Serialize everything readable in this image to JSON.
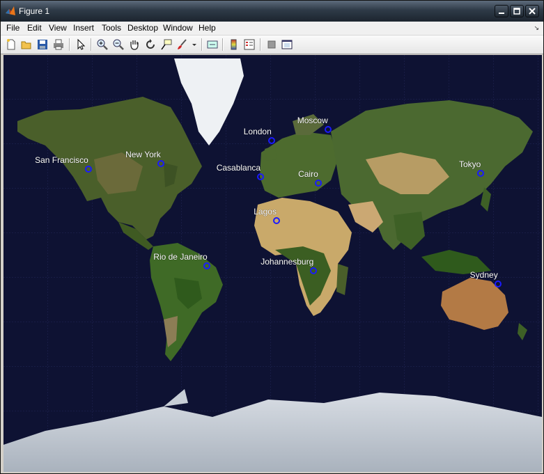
{
  "window": {
    "title": "Figure 1"
  },
  "menu": [
    "File",
    "Edit",
    "View",
    "Insert",
    "Tools",
    "Desktop",
    "Window",
    "Help"
  ],
  "toolbar": {
    "tools": [
      "new-figure",
      "open-file",
      "save",
      "print",
      "edit-plot",
      "zoom-in",
      "zoom-out",
      "pan",
      "rotate-3d",
      "data-cursor",
      "brush",
      "insert-colorbar",
      "insert-legend",
      "hide-plot-tools",
      "show-plot-tools"
    ]
  },
  "colors": {
    "marker": "#1a1aff",
    "ocean": "#0e1233",
    "label": "#ffffff"
  },
  "map": {
    "projection": "mercator",
    "basemap": "satellite imagery",
    "cities": [
      {
        "name": "San Francisco",
        "lat": 37.77,
        "lon": -122.42
      },
      {
        "name": "New York",
        "lat": 40.71,
        "lon": -74.01
      },
      {
        "name": "London",
        "lat": 51.51,
        "lon": -0.13
      },
      {
        "name": "Moscow",
        "lat": 55.76,
        "lon": 37.62
      },
      {
        "name": "Casablanca",
        "lat": 33.57,
        "lon": -7.59
      },
      {
        "name": "Cairo",
        "lat": 30.04,
        "lon": 31.24
      },
      {
        "name": "Tokyo",
        "lat": 35.68,
        "lon": 139.69
      },
      {
        "name": "Lagos",
        "lat": 6.52,
        "lon": 3.38
      },
      {
        "name": "Rio de Janeiro",
        "lat": -22.91,
        "lon": -43.17
      },
      {
        "name": "Johannesburg",
        "lat": -26.2,
        "lon": 28.05
      },
      {
        "name": "Sydney",
        "lat": -33.87,
        "lon": 151.21
      }
    ]
  }
}
